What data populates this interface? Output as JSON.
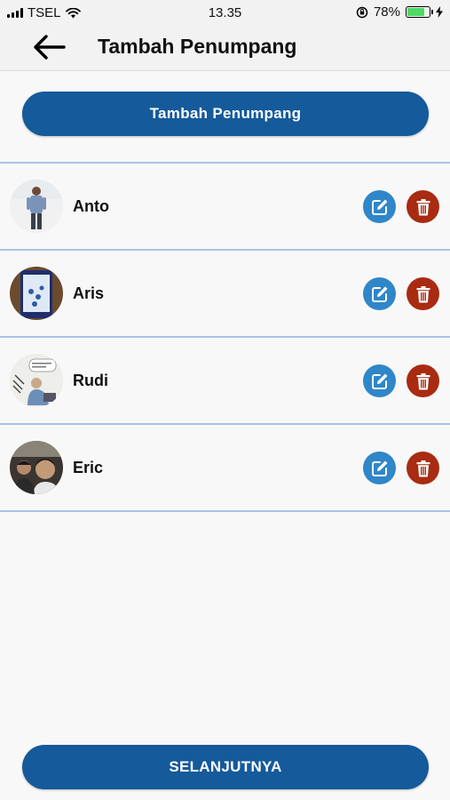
{
  "status_bar": {
    "carrier": "TSEL",
    "time": "13.35",
    "battery_percent": "78%",
    "battery_level": 0.78,
    "battery_color": "#4cd964"
  },
  "header": {
    "title": "Tambah Penumpang",
    "back_icon": "arrow-left-icon"
  },
  "actions": {
    "add_passenger_label": "Tambah Penumpang",
    "next_label": "SELANJUTNYA",
    "primary_color": "#155a9a"
  },
  "passengers": [
    {
      "name": "Anto"
    },
    {
      "name": "Aris"
    },
    {
      "name": "Rudi"
    },
    {
      "name": "Eric"
    }
  ],
  "row_icons": {
    "edit": "edit-icon",
    "delete": "trash-icon",
    "edit_color": "#2f86c8",
    "delete_color": "#a82b12"
  }
}
